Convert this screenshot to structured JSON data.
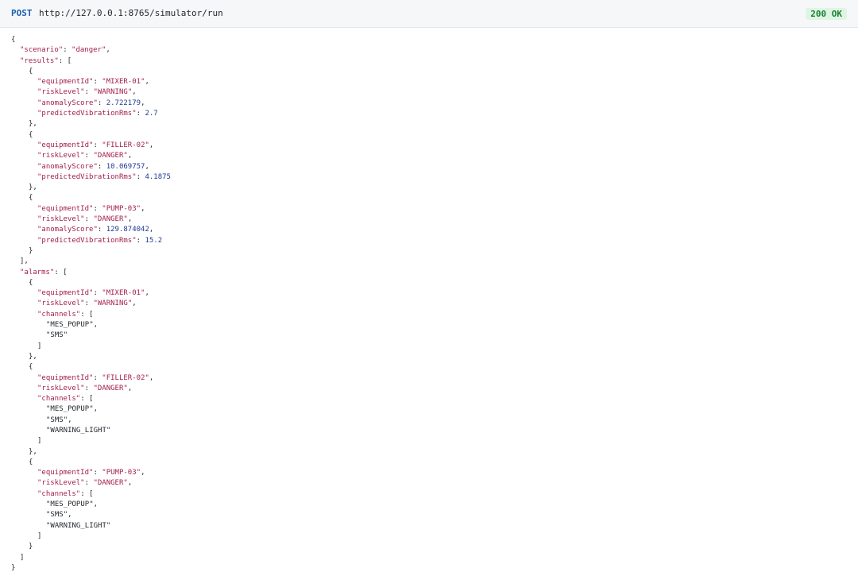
{
  "request": {
    "method": "POST",
    "url": "http://127.0.0.1:8765/simulator/run",
    "status": "200 OK",
    "status_color": "#1a7f37"
  },
  "response": {
    "scenario": "danger",
    "results": [
      {
        "equipmentId": "MIXER-01",
        "riskLevel": "WARNING",
        "anomalyScore": "2.722179",
        "predictedVibrationRms": "2.7"
      },
      {
        "equipmentId": "FILLER-02",
        "riskLevel": "DANGER",
        "anomalyScore": "10.069757",
        "predictedVibrationRms": "4.1875"
      },
      {
        "equipmentId": "PUMP-03",
        "riskLevel": "DANGER",
        "anomalyScore": "129.874042",
        "predictedVibrationRms": "15.2"
      }
    ],
    "alarms": [
      {
        "equipmentId": "MIXER-01",
        "riskLevel": "WARNING",
        "channels": [
          "MES_POPUP",
          "SMS"
        ]
      },
      {
        "equipmentId": "FILLER-02",
        "riskLevel": "DANGER",
        "channels": [
          "MES_POPUP",
          "SMS",
          "WARNING_LIGHT"
        ]
      },
      {
        "equipmentId": "PUMP-03",
        "riskLevel": "DANGER",
        "channels": [
          "MES_POPUP",
          "SMS",
          "WARNING_LIGHT"
        ]
      }
    ]
  }
}
